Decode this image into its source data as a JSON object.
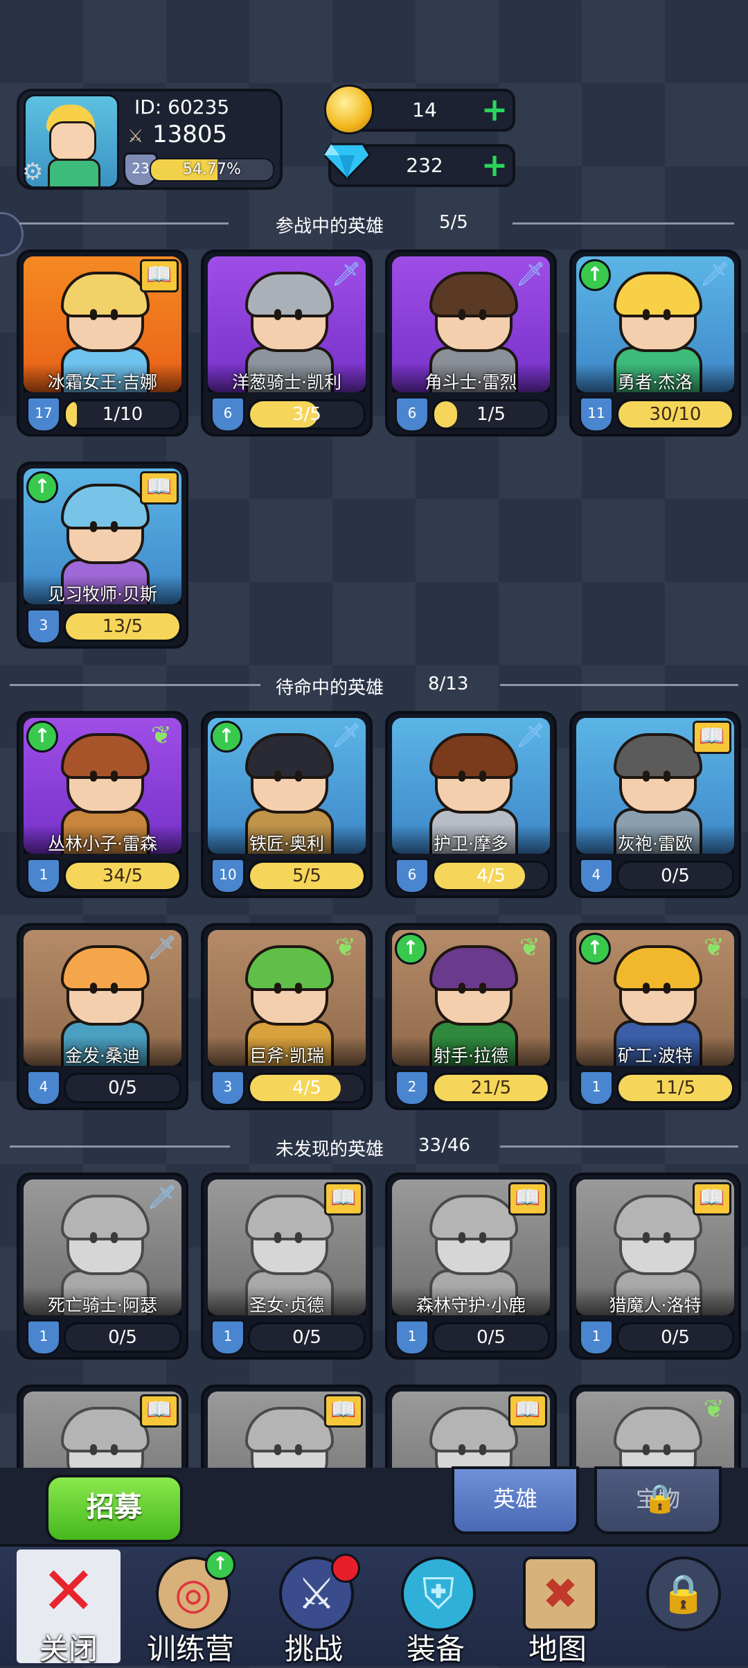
{
  "player": {
    "id_text": "ID:  60235",
    "power": "13805",
    "level": "23",
    "xp_text": "54.77%",
    "xp_fraction": 0.5477
  },
  "currency": {
    "gold": "14",
    "diamonds": "232"
  },
  "sections": {
    "deployed": {
      "title": "参战中的英雄",
      "count": "5/5"
    },
    "standby": {
      "title": "待命中的英雄",
      "count": "8/13"
    },
    "undiscovered": {
      "title": "未发现的英雄",
      "count": "33/46"
    }
  },
  "deployed_heroes": [
    {
      "name": "冰霜女王·吉娜",
      "level": "17",
      "progress": "1/10",
      "fill": 0.1,
      "bg": "orange",
      "badge": "book",
      "upgrade": false,
      "hair": "#f3d169",
      "outfit": "#6fc3ef"
    },
    {
      "name": "洋葱骑士·凯利",
      "level": "6",
      "progress": "3/5",
      "fill": 0.6,
      "bg": "purple",
      "badge": "sword",
      "upgrade": false,
      "hair": "#a9b0b8",
      "outfit": "#8d949e"
    },
    {
      "name": "角斗士·雷烈",
      "level": "6",
      "progress": "1/5",
      "fill": 0.2,
      "bg": "purple",
      "badge": "sword",
      "upgrade": false,
      "hair": "#5a3a24",
      "outfit": "#8b8f97"
    },
    {
      "name": "勇者·杰洛",
      "level": "11",
      "progress": "30/10",
      "fill": 1,
      "bg": "blue",
      "badge": "sword",
      "upgrade": true,
      "hair": "#f8d048",
      "outfit": "#3dbb7a"
    },
    {
      "name": "见习牧师·贝斯",
      "level": "3",
      "progress": "13/5",
      "fill": 1,
      "bg": "blue",
      "badge": "book",
      "upgrade": true,
      "hair": "#77c4e8",
      "outfit": "#9f69d8"
    }
  ],
  "standby_heroes": [
    {
      "name": "丛林小子·雷森",
      "level": "1",
      "progress": "34/5",
      "fill": 1,
      "bg": "purple",
      "badge": "wing",
      "upgrade": true,
      "hair": "#a8542a",
      "outfit": "#c9853d"
    },
    {
      "name": "铁匠·奥利",
      "level": "10",
      "progress": "5/5",
      "fill": 1,
      "bg": "blue",
      "badge": "sword",
      "upgrade": true,
      "hair": "#2a2a34",
      "outfit": "#c1944a"
    },
    {
      "name": "护卫·摩多",
      "level": "6",
      "progress": "4/5",
      "fill": 0.8,
      "bg": "blue",
      "badge": "sword",
      "upgrade": false,
      "hair": "#7a3a1c",
      "outfit": "#b7bcc5"
    },
    {
      "name": "灰袍·雷欧",
      "level": "4",
      "progress": "0/5",
      "fill": 0,
      "bg": "blue",
      "badge": "book",
      "upgrade": false,
      "hair": "#5b5b5b",
      "outfit": "#8aa0b0"
    },
    {
      "name": "金发·桑迪",
      "level": "4",
      "progress": "0/5",
      "fill": 0,
      "bg": "brown",
      "badge": "sword",
      "upgrade": false,
      "hair": "#f6a64a",
      "outfit": "#4aa0c0"
    },
    {
      "name": "巨斧·凯瑞",
      "level": "3",
      "progress": "4/5",
      "fill": 0.8,
      "bg": "brown",
      "badge": "wing",
      "upgrade": false,
      "hair": "#5fbf48",
      "outfit": "#d9a23c"
    },
    {
      "name": "射手·拉德",
      "level": "2",
      "progress": "21/5",
      "fill": 1,
      "bg": "brown",
      "badge": "wing",
      "upgrade": true,
      "hair": "#6a3a8c",
      "outfit": "#2f8a3e"
    },
    {
      "name": "矿工·波特",
      "level": "1",
      "progress": "11/5",
      "fill": 1,
      "bg": "brown",
      "badge": "wing",
      "upgrade": true,
      "hair": "#f1b82e",
      "outfit": "#3a5ea8"
    }
  ],
  "undiscovered_heroes": [
    {
      "name": "死亡骑士·阿瑟",
      "level": "1",
      "progress": "0/5",
      "fill": 0,
      "bg": "gray",
      "badge": "sword",
      "upgrade": false
    },
    {
      "name": "圣女·贞德",
      "level": "1",
      "progress": "0/5",
      "fill": 0,
      "bg": "gray",
      "badge": "book",
      "upgrade": false
    },
    {
      "name": "森林守护·小鹿",
      "level": "1",
      "progress": "0/5",
      "fill": 0,
      "bg": "gray",
      "badge": "book",
      "upgrade": false
    },
    {
      "name": "猎魔人·洛特",
      "level": "1",
      "progress": "0/5",
      "fill": 0,
      "bg": "gray",
      "badge": "book",
      "upgrade": false
    },
    {
      "name": "",
      "level": "",
      "progress": "",
      "fill": 0,
      "bg": "gray",
      "badge": "book",
      "upgrade": false
    },
    {
      "name": "",
      "level": "",
      "progress": "",
      "fill": 0,
      "bg": "gray",
      "badge": "book",
      "upgrade": false
    },
    {
      "name": "",
      "level": "",
      "progress": "",
      "fill": 0,
      "bg": "gray",
      "badge": "book",
      "upgrade": false
    },
    {
      "name": "",
      "level": "",
      "progress": "",
      "fill": 0,
      "bg": "gray",
      "badge": "wing",
      "upgrade": false
    }
  ],
  "bottom": {
    "recruit_label": "招募",
    "tab_heroes": "英雄",
    "tab_locked": "宝物"
  },
  "nav": [
    {
      "label": "关闭",
      "icon": "close-icon"
    },
    {
      "label": "训练营",
      "icon": "target-icon"
    },
    {
      "label": "挑战",
      "icon": "sword-shield-icon"
    },
    {
      "label": "装备",
      "icon": "armor-icon"
    },
    {
      "label": "地图",
      "icon": "map-icon"
    },
    {
      "label": "",
      "icon": "lock-icon"
    }
  ],
  "colors": {
    "gold_bar": "#f6d65a",
    "upgrade_green": "#38c94d",
    "recruit_green": "#44b81e"
  }
}
